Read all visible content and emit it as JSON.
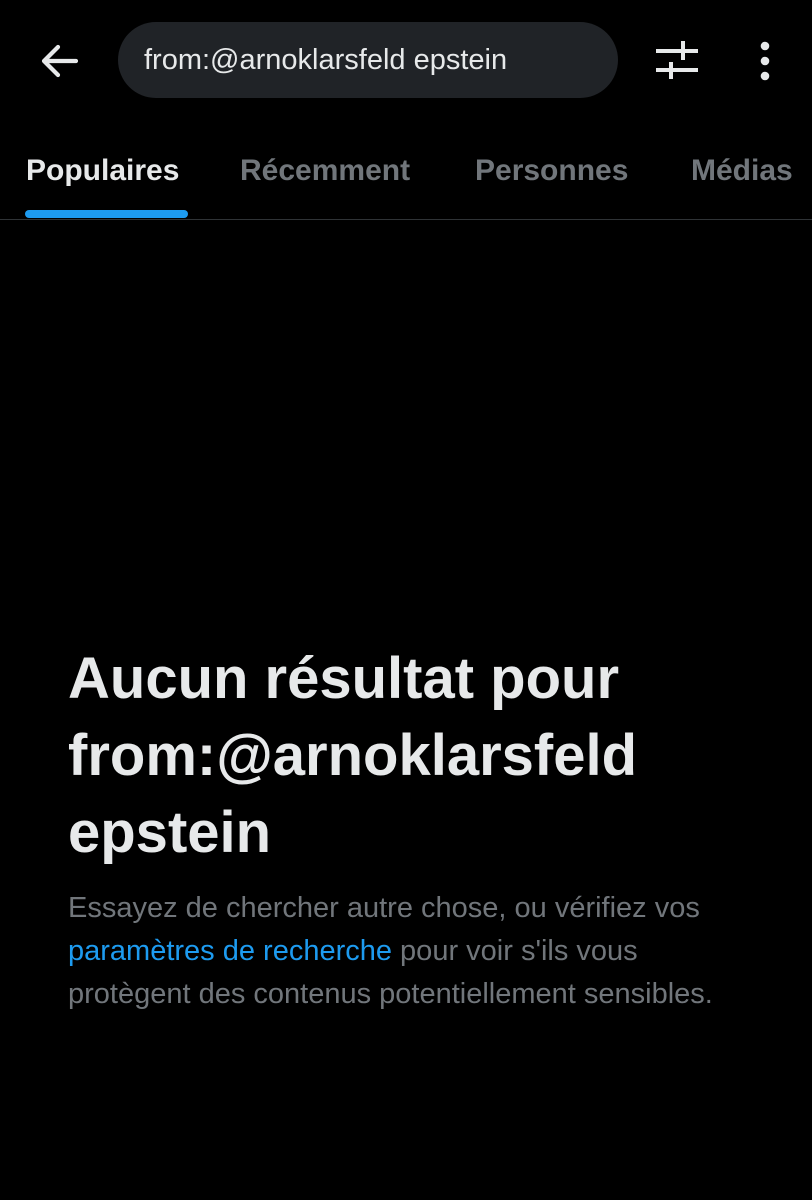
{
  "search": {
    "query": "from:@arnoklarsfeld epstein"
  },
  "tabs": [
    {
      "label": "Populaires",
      "active": true
    },
    {
      "label": "Récemment",
      "active": false
    },
    {
      "label": "Personnes",
      "active": false
    },
    {
      "label": "Médias",
      "active": false
    }
  ],
  "icons": {
    "back": "arrow-left-icon",
    "filter": "sliders-icon",
    "more": "more-vertical-icon"
  },
  "empty_state": {
    "title_line1": "Aucun résultat pour",
    "title_line2": "from:@arnoklarsfeld",
    "title_line3": "epstein",
    "body_before_link": "Essayez de chercher autre chose, ou vérifiez vos ",
    "link_text": "paramètres de recherche",
    "body_after_link": " pour voir s'ils vous protègent des contenus potentiellement sensibles."
  },
  "colors": {
    "background": "#000000",
    "accent": "#1d9bf0",
    "text_primary": "#e7e9ea",
    "text_secondary": "#71767b",
    "search_bg": "#202327"
  }
}
